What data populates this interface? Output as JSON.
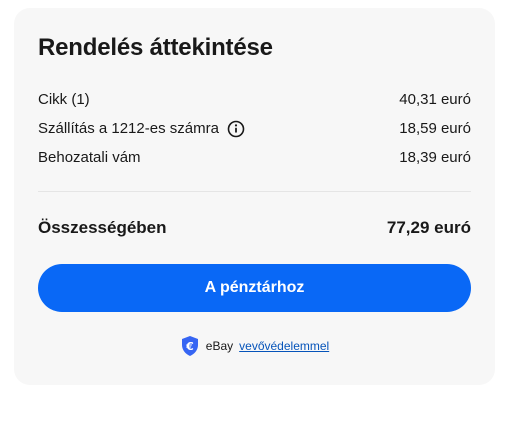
{
  "summary": {
    "title": "Rendelés áttekintése",
    "rows": [
      {
        "label": "Cikk (1)",
        "value": "40,31 euró"
      },
      {
        "label": "Szállítás a 1212-es számra",
        "value": "18,59 euró",
        "icon": "info-icon"
      },
      {
        "label": "Behozatali vám",
        "value": "18,39 euró"
      }
    ],
    "total_label": "Összességében",
    "total_value": "77,29 euró"
  },
  "checkout": {
    "label": "A pénztárhoz"
  },
  "protection": {
    "icon": "euro-shield-icon",
    "prefix": "eBay",
    "link_text": "vevővédelemmel"
  },
  "colors": {
    "accent": "#0968f6",
    "link": "#0654ba",
    "card_bg": "#f7f7f7"
  }
}
